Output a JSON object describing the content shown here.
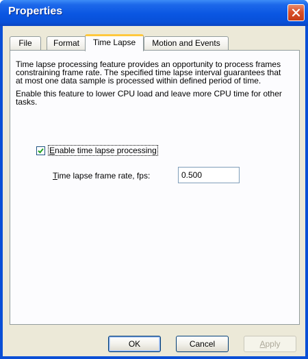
{
  "window": {
    "title": "Properties"
  },
  "tabs": [
    {
      "label": "File"
    },
    {
      "label": "Format"
    },
    {
      "label": "Time Lapse"
    },
    {
      "label": "Motion and Events"
    }
  ],
  "active_tab": "Time Lapse",
  "time_lapse": {
    "description_1": "Time lapse processing feature provides an opportunity to process frames constraining frame rate. The specified time lapse interval guarantees that at most one data sample is processed within defined period of time.",
    "description_2": "Enable this feature to lower CPU load and leave more CPU time for other tasks.",
    "enable_checkbox": {
      "label_mnemonic": "E",
      "label_rest": "nable time lapse processing",
      "checked": true
    },
    "frame_rate": {
      "label_mnemonic": "T",
      "label_rest": "ime lapse frame rate, fps:",
      "value": "0.500"
    }
  },
  "buttons": {
    "ok": "OK",
    "cancel": "Cancel",
    "apply_mnemonic": "A",
    "apply_rest": "pply"
  },
  "colors": {
    "titlebar": "#0a56e2",
    "close_button": "#d9502a",
    "dialog_face": "#ece9d8",
    "active_tab_highlight": "#ffc83c"
  },
  "icons": {
    "close": "close-x-icon",
    "check": "checkmark-icon"
  }
}
